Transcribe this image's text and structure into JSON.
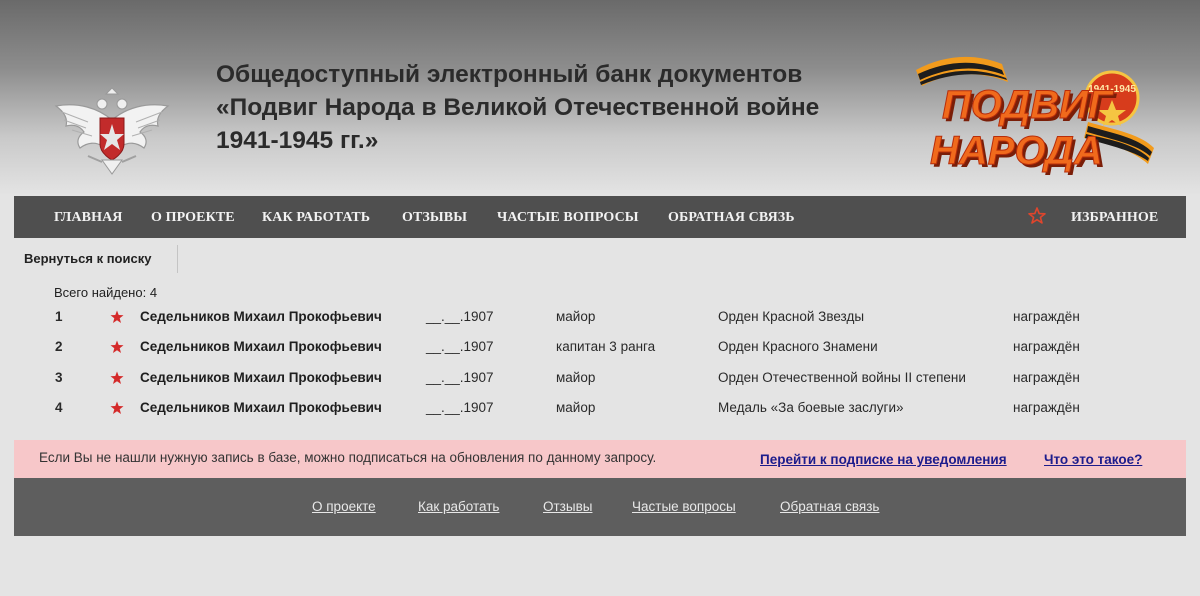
{
  "header": {
    "title_lines": [
      "Общедоступный электронный банк документов",
      "«Подвиг Народа в Великой Отечественной войне",
      "1941-1945 гг.»"
    ],
    "logo": {
      "word1": "ПОДВИГ",
      "word2": "НАРОДА",
      "years": "1941-1945"
    }
  },
  "nav": {
    "items": [
      "ГЛАВНАЯ",
      "О ПРОЕКТЕ",
      "КАК РАБОТАТЬ",
      "ОТЗЫВЫ",
      "ЧАСТЫЕ ВОПРОСЫ",
      "ОБРАТНАЯ СВЯЗЬ"
    ],
    "favorites_label": "ИЗБРАННОЕ",
    "favorites_icon": "star-outline-icon"
  },
  "back_link": "Вернуться к поиску",
  "results": {
    "total_text": "Всего найдено: 4",
    "rows": [
      {
        "num": "1",
        "name": "Седельников Михаил Прокофьевич",
        "date": "__.__.1907",
        "rank": "майор",
        "award": "Орден Красной Звезды",
        "status": "награждён"
      },
      {
        "num": "2",
        "name": "Седельников Михаил Прокофьевич",
        "date": "__.__.1907",
        "rank": "капитан 3 ранга",
        "award": "Орден Красного Знамени",
        "status": "награждён"
      },
      {
        "num": "3",
        "name": "Седельников Михаил Прокофьевич",
        "date": "__.__.1907",
        "rank": "майор",
        "award": "Орден Отечественной войны II степени",
        "status": "награждён"
      },
      {
        "num": "4",
        "name": "Седельников Михаил Прокофьевич",
        "date": "__.__.1907",
        "rank": "майор",
        "award": "Медаль «За боевые заслуги»",
        "status": "награждён"
      }
    ]
  },
  "notice": {
    "text": "Если Вы не нашли нужную запись в базе, можно подписаться на обновления по данному запросу.",
    "subscribe_link": "Перейти к подписке на уведомления",
    "what_link": "Что это такое?"
  },
  "footer": {
    "links": [
      "О проекте",
      "Как работать",
      "Отзывы",
      "Частые вопросы",
      "Обратная связь"
    ]
  },
  "colors": {
    "nav_bg": "#4f4f4f",
    "footer_bg": "#5e5e5e",
    "notice_bg": "#f7c7c9",
    "star_red": "#d42a2a",
    "link_blue": "#1c1c8c"
  }
}
